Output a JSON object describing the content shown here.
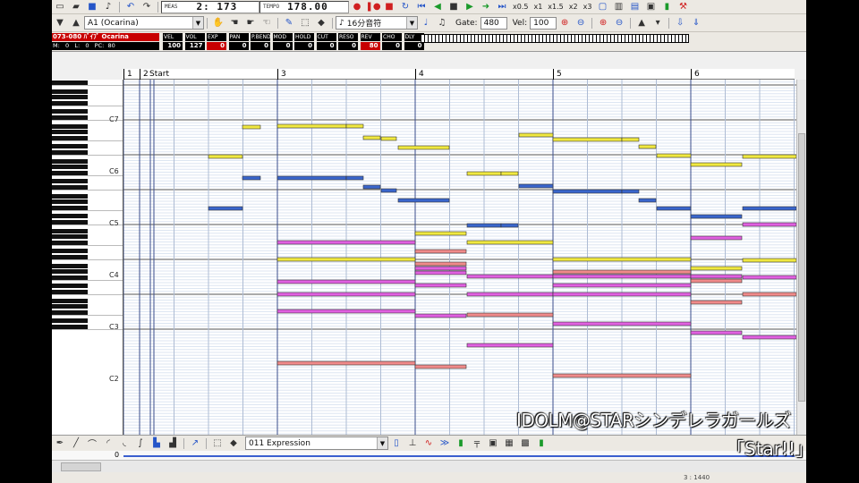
{
  "toolbar": {
    "meas_label": "MEAS",
    "meas_value": "2: 173",
    "tempo_label": "TEMPO",
    "tempo_value": "178.00",
    "rates": [
      "x0.5",
      "x1",
      "x1.5",
      "x2",
      "x3"
    ]
  },
  "track_bar": {
    "track_select": "A1 (Ocarina)",
    "note_length": "16分音符",
    "gate_label": "Gate:",
    "gate_value": "480",
    "vel_label": "Vel:",
    "vel_value": "100"
  },
  "track_info": {
    "name": "073-080 ﾊﾞｲﾌﾞ Ocarina",
    "meta": "M:   0   L:   0   PC:  80",
    "params": [
      {
        "label": "VEL",
        "value": "100"
      },
      {
        "label": "VOL",
        "value": "127"
      },
      {
        "label": "EXP",
        "value": "0"
      },
      {
        "label": "PAN",
        "value": "0"
      },
      {
        "label": "P.BEND",
        "value": "0"
      },
      {
        "label": "MOD",
        "value": "0"
      },
      {
        "label": "HOLD",
        "value": "0"
      },
      {
        "label": "CUT",
        "value": "0"
      },
      {
        "label": "RESO",
        "value": "0"
      },
      {
        "label": "REV",
        "value": "80"
      },
      {
        "label": "CHO",
        "value": "0"
      },
      {
        "label": "DLY",
        "value": "0"
      }
    ]
  },
  "ruler": {
    "markers": [
      {
        "label": "1"
      },
      {
        "label": "2"
      },
      {
        "label": "Start"
      },
      {
        "label": "3"
      },
      {
        "label": "4"
      },
      {
        "label": "5"
      },
      {
        "label": "6"
      }
    ]
  },
  "keyboard": {
    "octave_labels": [
      "C7",
      "C6",
      "C5",
      "C4",
      "C3",
      "C2"
    ]
  },
  "controller": {
    "select": "011 Expression",
    "zero_label": "0"
  },
  "status": {
    "position": "3 : 1440"
  },
  "captions": {
    "line1": "IDOLM@STARシンデレラガールズ",
    "line2": "「Star!!」"
  },
  "colors": {
    "yellow_note": "#f0e840",
    "blue_note": "#3a66cc",
    "pink_note": "#e060e0",
    "salmon_note": "#f08a8a"
  }
}
